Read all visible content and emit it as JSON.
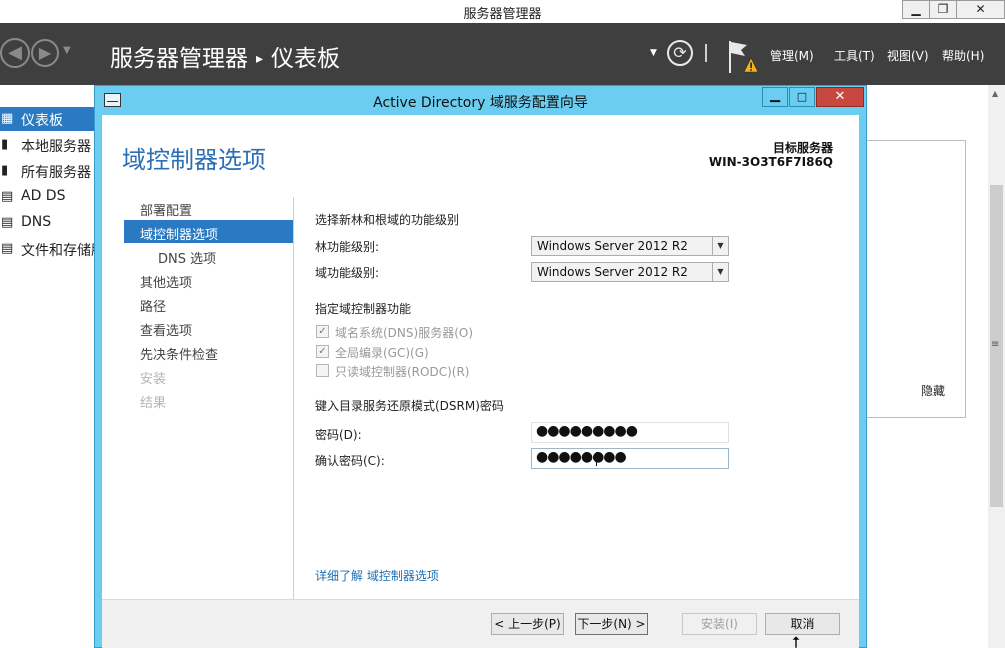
{
  "outer_window": {
    "title": "服务器管理器",
    "min_glyph": "▁",
    "max_glyph": "❐",
    "close_glyph": "✕"
  },
  "header": {
    "back_icon": "◀",
    "forward_icon": "▶",
    "nav_dropdown_icon": "▼",
    "breadcrumb_app": "服务器管理器",
    "breadcrumb_sep": "▸",
    "breadcrumb_page": "仪表板",
    "dropdown_icon": "▼",
    "refresh_icon": "⟳",
    "menus": [
      "管理(M)",
      "工具(T)",
      "视图(V)",
      "帮助(H)"
    ]
  },
  "leftnav": {
    "items": [
      {
        "icon": "▦",
        "label": "仪表板",
        "active": true
      },
      {
        "icon": "▮",
        "label": "本地服务器",
        "active": false
      },
      {
        "icon": "▮",
        "label": "所有服务器",
        "active": false
      },
      {
        "icon": "▤",
        "label": "AD DS",
        "active": false
      },
      {
        "icon": "▤",
        "label": "DNS",
        "active": false
      },
      {
        "icon": "▤",
        "label": "文件和存储服务",
        "active": false
      }
    ]
  },
  "background": {
    "hide_label": "隐藏",
    "scroll_up_glyph": "▲",
    "scroll_grip_glyph": "≡"
  },
  "dialog": {
    "title": "Active Directory 域服务配置向导",
    "min_glyph": "▁",
    "max_glyph": "□",
    "close_glyph": "✕",
    "page_title": "域控制器选项",
    "target_server_label": "目标服务器",
    "target_server_value": "WIN-3O3T6F7I86Q",
    "steps": [
      {
        "label": "部署配置",
        "state": "normal"
      },
      {
        "label": "域控制器选项",
        "state": "active"
      },
      {
        "label": "DNS 选项",
        "state": "sub"
      },
      {
        "label": "其他选项",
        "state": "normal"
      },
      {
        "label": "路径",
        "state": "normal"
      },
      {
        "label": "查看选项",
        "state": "normal"
      },
      {
        "label": "先决条件检查",
        "state": "normal"
      },
      {
        "label": "安装",
        "state": "disabled"
      },
      {
        "label": "结果",
        "state": "disabled"
      }
    ],
    "func_level_section": "选择新林和根域的功能级别",
    "forest_level_label": "林功能级别:",
    "forest_level_value": "Windows Server 2012 R2",
    "domain_level_label": "域功能级别:",
    "domain_level_value": "Windows Server 2012 R2",
    "dc_caps_section": "指定域控制器功能",
    "capabilities": [
      {
        "label": "域名系统(DNS)服务器(O)",
        "checked": true
      },
      {
        "label": "全局编录(GC)(G)",
        "checked": true
      },
      {
        "label": "只读域控制器(RODC)(R)",
        "checked": false
      }
    ],
    "dsrm_section": "键入目录服务还原模式(DSRM)密码",
    "password_label": "密码(D):",
    "password_value": "●●●●●●●●●",
    "confirm_label": "确认密码(C):",
    "confirm_value": "●●●●●●●●",
    "more_link": "详细了解 域控制器选项",
    "buttons": {
      "prev": "< 上一步(P)",
      "next": "下一步(N) >",
      "install": "安装(I)",
      "cancel": "取消"
    },
    "check_glyph": "✓",
    "arrow_glyph": "▼"
  }
}
